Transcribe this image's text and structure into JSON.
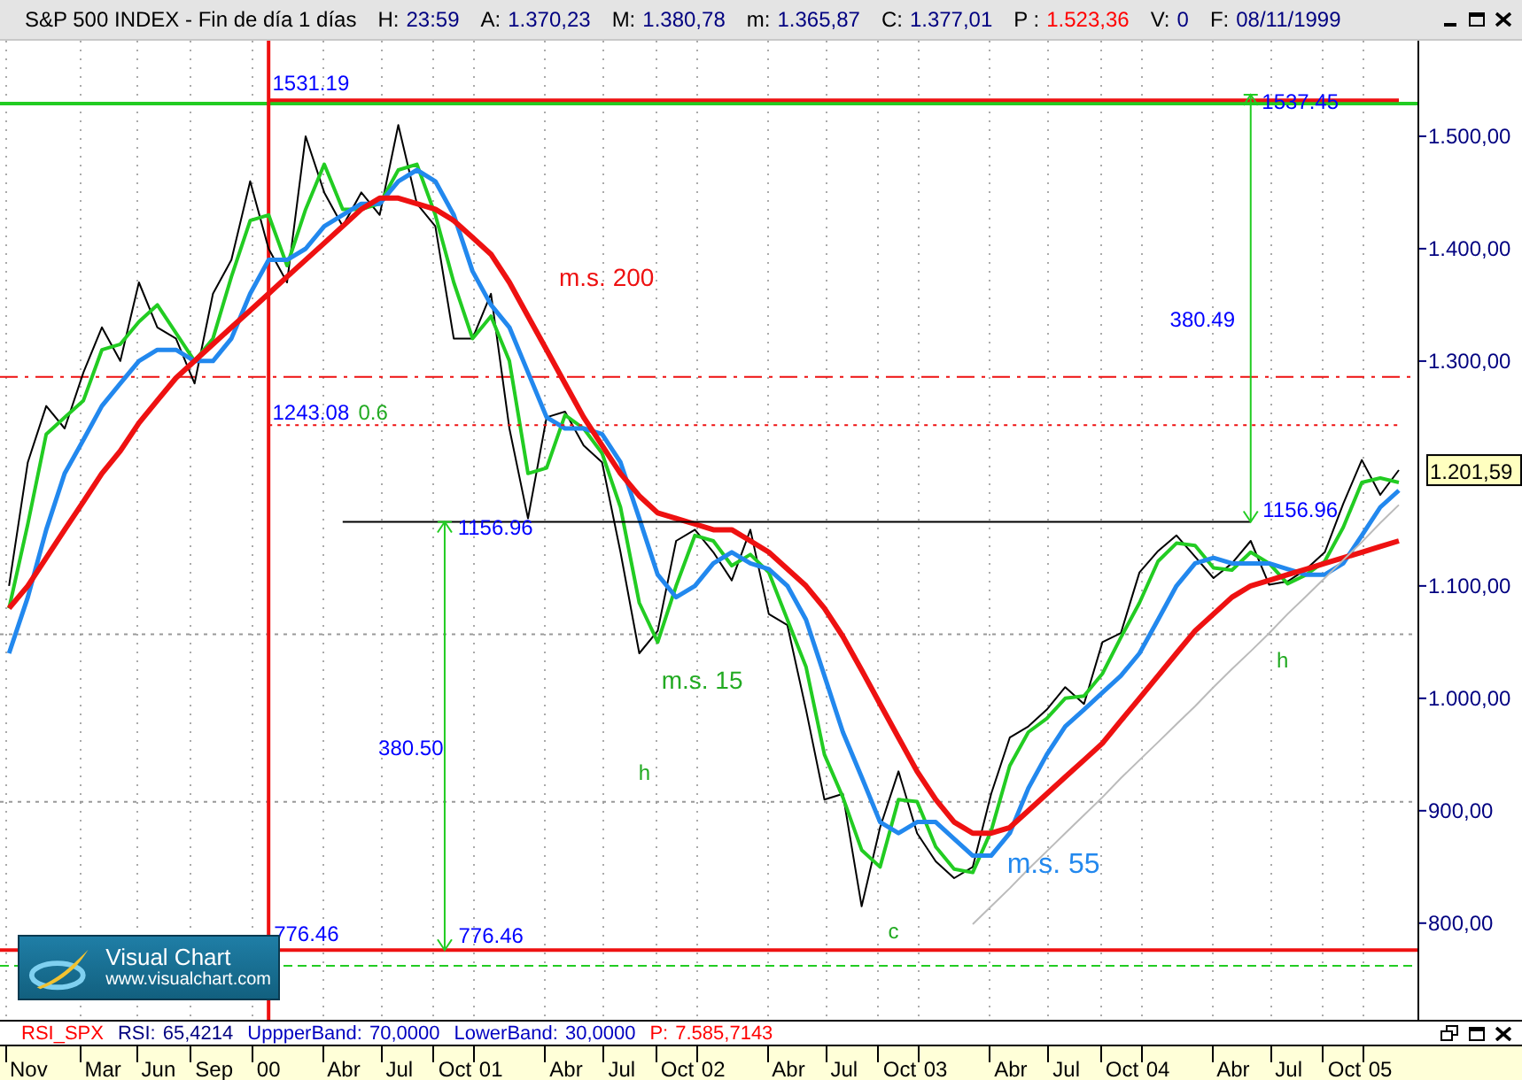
{
  "window": {
    "title": "S&P 500 INDEX - Fin de día 1 días",
    "fields": [
      {
        "label": "H:",
        "value": "23:59",
        "color": "#000080"
      },
      {
        "label": "A:",
        "value": "1.370,23",
        "color": "#000080"
      },
      {
        "label": "M:",
        "value": "1.380,78",
        "color": "#000080"
      },
      {
        "label": "m:",
        "value": "1.365,87",
        "color": "#000080"
      },
      {
        "label": "C:",
        "value": "1.377,01",
        "color": "#000080"
      },
      {
        "label": "P :",
        "value": "1.523,36",
        "color": "#ff0000"
      },
      {
        "label": "V:",
        "value": "0",
        "color": "#000080"
      },
      {
        "label": "F:",
        "value": "08/11/1999",
        "color": "#000080"
      }
    ]
  },
  "chart": {
    "chart_data": {
      "type": "line",
      "x": [
        -1.167,
        -1.083,
        -1,
        -0.917,
        -0.833,
        -0.75,
        -0.667,
        -0.583,
        -0.5,
        -0.417,
        -0.333,
        -0.25,
        -0.167,
        -0.083,
        0,
        0.083,
        0.167,
        0.25,
        0.333,
        0.417,
        0.5,
        0.583,
        0.667,
        0.75,
        0.833,
        0.917,
        1,
        1.083,
        1.167,
        1.25,
        1.333,
        1.417,
        1.5,
        1.583,
        1.667,
        1.75,
        1.833,
        1.917,
        2,
        2.083,
        2.167,
        2.25,
        2.333,
        2.417,
        2.5,
        2.583,
        2.667,
        2.75,
        2.833,
        2.917,
        3,
        3.083,
        3.167,
        3.25,
        3.333,
        3.417,
        3.5,
        3.583,
        3.667,
        3.75,
        3.833,
        3.917,
        4,
        4.083,
        4.167,
        4.25,
        4.333,
        4.417,
        4.5,
        4.583,
        4.667,
        4.75,
        4.833,
        4.917,
        5,
        5.083
      ],
      "series": [
        {
          "color": "#000000",
          "values": [
            1100,
            1210,
            1260,
            1240,
            1290,
            1330,
            1300,
            1370,
            1330,
            1320,
            1280,
            1360,
            1390,
            1460,
            1400,
            1370,
            1500,
            1450,
            1420,
            1450,
            1430,
            1510,
            1440,
            1420,
            1320,
            1320,
            1360,
            1240,
            1160,
            1250,
            1255,
            1225,
            1210,
            1130,
            1040,
            1060,
            1140,
            1150,
            1130,
            1105,
            1150,
            1075,
            1065,
            990,
            910,
            915,
            815,
            885,
            935,
            880,
            855,
            840,
            850,
            915,
            965,
            975,
            990,
            1010,
            995,
            1050,
            1058,
            1112,
            1131,
            1145,
            1126,
            1107,
            1120,
            1140,
            1101,
            1104,
            1115,
            1130,
            1173,
            1212,
            1181,
            1203
          ]
        },
        {
          "color": "#22cc22",
          "values": [
            1080,
            1155,
            1235,
            1250,
            1265,
            1310,
            1315,
            1335,
            1350,
            1325,
            1300,
            1320,
            1375,
            1425,
            1430,
            1385,
            1435,
            1475,
            1435,
            1435,
            1440,
            1470,
            1475,
            1430,
            1370,
            1320,
            1340,
            1300,
            1200,
            1205,
            1252,
            1240,
            1218,
            1170,
            1085,
            1050,
            1100,
            1145,
            1140,
            1118,
            1128,
            1112,
            1070,
            1028,
            950,
            912,
            865,
            850,
            910,
            908,
            868,
            848,
            845,
            882,
            940,
            970,
            982,
            1000,
            1002,
            1022,
            1054,
            1085,
            1122,
            1138,
            1136,
            1116,
            1114,
            1130,
            1120,
            1102,
            1110,
            1122,
            1152,
            1192,
            1196,
            1192
          ]
        },
        {
          "color": "#2288ee",
          "values": [
            1040,
            1090,
            1150,
            1200,
            1230,
            1260,
            1280,
            1300,
            1310,
            1310,
            1300,
            1300,
            1320,
            1360,
            1390,
            1390,
            1400,
            1420,
            1430,
            1440,
            1440,
            1460,
            1470,
            1460,
            1430,
            1380,
            1350,
            1330,
            1290,
            1250,
            1240,
            1240,
            1235,
            1210,
            1160,
            1110,
            1090,
            1100,
            1120,
            1130,
            1120,
            1115,
            1100,
            1070,
            1020,
            970,
            930,
            890,
            880,
            890,
            890,
            875,
            860,
            860,
            880,
            920,
            950,
            975,
            990,
            1005,
            1020,
            1040,
            1070,
            1100,
            1120,
            1125,
            1120,
            1120,
            1120,
            1115,
            1110,
            1110,
            1120,
            1145,
            1170,
            1185
          ]
        },
        {
          "color": "#ee1111",
          "values": [
            1080,
            1100,
            1125,
            1150,
            1175,
            1200,
            1220,
            1245,
            1265,
            1285,
            1300,
            1315,
            1330,
            1345,
            1360,
            1375,
            1390,
            1405,
            1420,
            1435,
            1445,
            1445,
            1440,
            1435,
            1425,
            1410,
            1395,
            1370,
            1340,
            1310,
            1280,
            1250,
            1225,
            1200,
            1180,
            1165,
            1160,
            1155,
            1150,
            1150,
            1140,
            1130,
            1115,
            1100,
            1080,
            1055,
            1025,
            995,
            965,
            935,
            910,
            890,
            880,
            880,
            885,
            900,
            915,
            930,
            945,
            960,
            980,
            1000,
            1020,
            1040,
            1060,
            1075,
            1090,
            1100,
            1105,
            1110,
            1115,
            1120,
            1125,
            1130,
            1135,
            1140
          ]
        },
        {
          "color": "#ee1111",
          "values": [
            null,
            null,
            null,
            null,
            null,
            null,
            null,
            null,
            null,
            null,
            null,
            null,
            null,
            null,
            1532,
            1532,
            1532,
            1532,
            1532,
            1532,
            1532,
            1532,
            1532,
            1532,
            1532,
            1532,
            1532,
            1532,
            1532,
            1532,
            1532,
            1532,
            1532,
            1532,
            1532,
            1532,
            1532,
            1532,
            1532,
            1532,
            1532,
            1532,
            1532,
            1532,
            1532,
            1532,
            1532,
            1532,
            1532,
            1532,
            1532,
            1532,
            1532,
            1532,
            1532,
            1532,
            1532,
            1532,
            1532,
            1532,
            1532,
            1532,
            1532,
            1532,
            1532,
            1532,
            1532,
            1532,
            1532,
            1532,
            1532,
            1532,
            1532,
            1532,
            1532,
            1532
          ]
        },
        {
          "color": "#ee1111",
          "line_style": "dotted",
          "values": [
            null,
            null,
            null,
            null,
            null,
            null,
            null,
            null,
            null,
            null,
            null,
            null,
            null,
            null,
            1243,
            1243,
            1243,
            1243,
            1243,
            1243,
            1243,
            1243,
            1243,
            1243,
            1243,
            1243,
            1243,
            1243,
            1243,
            1243,
            1243,
            1243,
            1243,
            1243,
            1243,
            1243,
            1243,
            1243,
            1243,
            1243,
            1243,
            1243,
            1243,
            1243,
            1243,
            1243,
            1243,
            1243,
            1243,
            1243,
            1243,
            1243,
            1243,
            1243,
            1243,
            1243,
            1243,
            1243,
            1243,
            1243,
            1243,
            1243,
            1243,
            1243,
            1243,
            1243,
            1243,
            1243,
            1243,
            1243,
            1243,
            1243,
            1243,
            1243,
            1243,
            1243
          ]
        },
        {
          "color": "#000000",
          "values": [
            null,
            null,
            null,
            null,
            null,
            null,
            null,
            null,
            null,
            null,
            null,
            null,
            null,
            null,
            null,
            null,
            null,
            null,
            1157,
            1157,
            1157,
            1157,
            1157,
            1157,
            1157,
            1157,
            1157,
            1157,
            1157,
            1157,
            1157,
            1157,
            1157,
            1157,
            1157,
            1157,
            1157,
            1157,
            1157,
            1157,
            1157,
            1157,
            1157,
            1157,
            1157,
            1157,
            1157,
            1157,
            1157,
            1157,
            1157,
            1157,
            1157,
            1157,
            1157,
            1157,
            1157,
            1157,
            1157,
            1157,
            1157,
            1157,
            1157,
            1157,
            1157,
            1157,
            1157,
            1157,
            null,
            null,
            null,
            null,
            null,
            null,
            null,
            null
          ]
        },
        {
          "color": "#bbbbbb",
          "values": [
            null,
            null,
            null,
            null,
            null,
            null,
            null,
            null,
            null,
            null,
            null,
            null,
            null,
            null,
            null,
            null,
            null,
            null,
            null,
            null,
            null,
            null,
            null,
            null,
            null,
            null,
            null,
            null,
            null,
            null,
            null,
            null,
            null,
            null,
            null,
            null,
            null,
            null,
            null,
            null,
            null,
            null,
            null,
            null,
            null,
            null,
            null,
            null,
            null,
            null,
            null,
            null,
            799,
            815,
            831,
            848,
            864,
            880,
            896,
            912,
            929,
            945,
            961,
            977,
            993,
            1010,
            1026,
            1042,
            1058,
            1075,
            1091,
            1107,
            1123,
            1139,
            1156,
            1172
          ]
        }
      ],
      "xlim": [
        -1.208,
        5.167
      ],
      "ylim": [
        714,
        1585
      ],
      "xticks": [
        {
          "value": -1.079,
          "label": "Nov"
        },
        {
          "value": -0.745,
          "label": "Mar"
        },
        {
          "value": -0.495,
          "label": "Jun"
        },
        {
          "value": -0.245,
          "label": "Sep"
        },
        {
          "value": 0,
          "label": "00"
        },
        {
          "value": 0.338,
          "label": "Abr"
        },
        {
          "value": 0.588,
          "label": "Jul"
        },
        {
          "value": 0.838,
          "label": "Oct"
        },
        {
          "value": 1,
          "label": "01"
        },
        {
          "value": 1.338,
          "label": "Abr"
        },
        {
          "value": 1.588,
          "label": "Jul"
        },
        {
          "value": 1.838,
          "label": "Oct"
        },
        {
          "value": 2,
          "label": "02"
        },
        {
          "value": 2.338,
          "label": "Abr"
        },
        {
          "value": 2.588,
          "label": "Jul"
        },
        {
          "value": 2.838,
          "label": "Oct"
        },
        {
          "value": 3,
          "label": "03"
        },
        {
          "value": 3.338,
          "label": "Abr"
        },
        {
          "value": 3.588,
          "label": "Jul"
        },
        {
          "value": 3.838,
          "label": "Oct"
        },
        {
          "value": 4,
          "label": "04"
        },
        {
          "value": 4.338,
          "label": "Abr"
        },
        {
          "value": 4.588,
          "label": "Jul"
        },
        {
          "value": 4.838,
          "label": "Oct"
        },
        {
          "value": 5,
          "label": "05"
        }
      ],
      "yticks": [
        {
          "value": 800,
          "label": "800,00"
        },
        {
          "value": 900,
          "label": "900,00"
        },
        {
          "value": 1000,
          "label": "1.000,00"
        },
        {
          "value": 1100,
          "label": "1.100,00"
        },
        {
          "value": 1300,
          "label": "1.300,00"
        },
        {
          "value": 1400,
          "label": "1.400,00"
        },
        {
          "value": 1500,
          "label": "1.500,00"
        }
      ],
      "ref_lines": [
        {
          "axis": "y",
          "value": 1057,
          "color": "#999999"
        },
        {
          "axis": "y",
          "value": 908,
          "color": "#999999"
        },
        {
          "axis": "y",
          "value": 1286,
          "color": "#ee1111"
        },
        {
          "axis": "y",
          "value": 1529,
          "color": "#22cc22"
        },
        {
          "axis": "y",
          "value": 776,
          "color": "#ee1111"
        },
        {
          "axis": "y",
          "value": 762,
          "color": "#22cc22"
        },
        {
          "axis": "x",
          "value": 0,
          "color": "#ee1111"
        }
      ],
      "annotations": [
        "1531.19",
        "1537.45",
        "m.s. 200",
        "380.49",
        "1243.08",
        "0.6",
        "1156.96",
        "1156.96",
        "m.s. 15",
        "h",
        "380.50",
        "m.s. 55",
        "h",
        "c",
        "776.46",
        "776.46"
      ]
    },
    "price_tag": "1.201,59",
    "logo": {
      "name": "Visual Chart",
      "url": "www.visualchart.com"
    },
    "indicator_bar": {
      "name": "RSI_SPX",
      "fields": [
        {
          "label": "RSI:",
          "value": "65,4214",
          "color": "#000080"
        },
        {
          "label": "UppperBand:",
          "value": "70,0000",
          "color": "#0000c0"
        },
        {
          "label": "LowerBand:",
          "value": "30,0000",
          "color": "#0000c0"
        },
        {
          "label": "P:",
          "value": "7.585,7143",
          "color": "#ff0000"
        }
      ]
    }
  }
}
